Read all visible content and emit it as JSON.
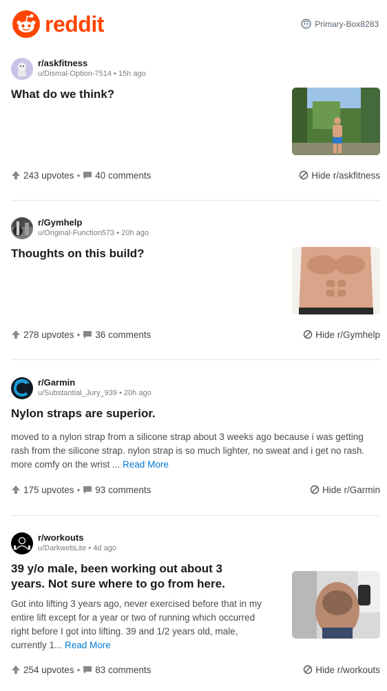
{
  "header": {
    "logo_text": "reddit",
    "username": "Primary-Box8283"
  },
  "colors": {
    "brand": "#ff4500",
    "link": "#0079d3",
    "muted": "#7c7c7c"
  },
  "posts": [
    {
      "subreddit": "r/askfitness",
      "byline": "u/Dismal-Option-7514 • 15h ago",
      "title": "What do we think?",
      "upvotes": "243 upvotes",
      "comments": "40 comments",
      "hide": "Hide r/askfitness"
    },
    {
      "subreddit": "r/Gymhelp",
      "byline": "u/Original-Function573 • 20h ago",
      "title": "Thoughts on this build?",
      "upvotes": "278 upvotes",
      "comments": "36 comments",
      "hide": "Hide r/Gymhelp"
    },
    {
      "subreddit": "r/Garmin",
      "byline": "u/Substantial_Jury_939 • 20h ago",
      "title": "Nylon straps are superior.",
      "body_lines": [
        "moved to a nylon strap from a silicone strap about 3 weeks ago because i was getting",
        "rash from the silicone strap. nylon strap is so much lighter, no sweat and i get no rash.",
        "more comfy on the wrist ... "
      ],
      "read_more": "Read More",
      "upvotes": "175 upvotes",
      "comments": "93 comments",
      "hide": "Hide r/Garmin"
    },
    {
      "subreddit": "r/workouts",
      "byline": "u/DarkwebLite • 4d ago",
      "title_lines": [
        "39 y/o male, been working out about 3",
        "years. Not sure where to go from here."
      ],
      "body_lines": [
        "Got into lifting 3 years ago, never exercised before that in my",
        "entire lift except for a year or two of running which occurred",
        "right before I got into lifting. 39 and 1/2 years old, male,",
        "currently 1... "
      ],
      "read_more": "Read More",
      "upvotes": "254 upvotes",
      "comments": "83 comments",
      "hide": "Hide r/workouts"
    }
  ],
  "separator": "•"
}
